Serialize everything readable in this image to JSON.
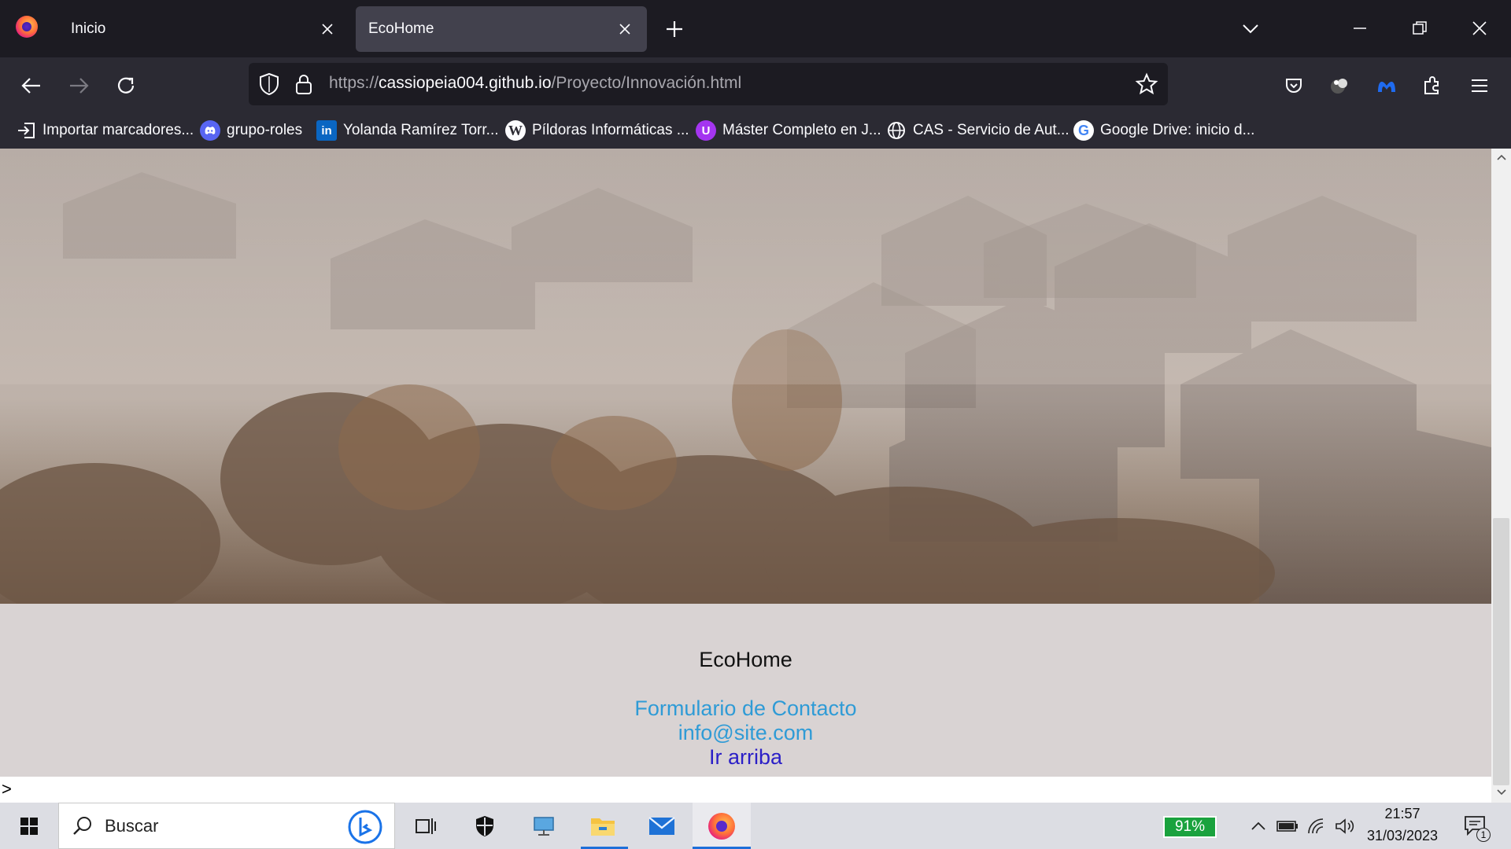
{
  "tabs": [
    {
      "label": "Inicio",
      "active": false
    },
    {
      "label": "EcoHome",
      "active": true
    }
  ],
  "url": {
    "protocol": "https://",
    "host": "cassiopeia004.github.io",
    "path": "/Proyecto/Innovación.html"
  },
  "bookmarks": [
    {
      "label": "Importar marcadores...",
      "icon": "import-icon"
    },
    {
      "label": "grupo-roles",
      "icon": "discord-icon"
    },
    {
      "label": "Yolanda Ramírez Torr...",
      "icon": "linkedin-icon"
    },
    {
      "label": "Píldoras Informáticas ...",
      "icon": "wordpress-icon"
    },
    {
      "label": "Máster Completo en J...",
      "icon": "udemy-icon"
    },
    {
      "label": "CAS - Servicio de Aut...",
      "icon": "globe-icon"
    },
    {
      "label": "Google Drive: inicio d...",
      "icon": "google-icon"
    }
  ],
  "page": {
    "footer_title": "EcoHome",
    "links": {
      "contact_form": "Formulario de Contacto",
      "email": "info@site.com",
      "back_to_top": "Ir arriba"
    },
    "stray_text": ">"
  },
  "taskbar": {
    "search_placeholder": "Buscar",
    "battery": "91%",
    "time": "21:57",
    "date": "31/03/2023",
    "notifications": "1"
  },
  "colors": {
    "link": "#2f9bd6",
    "visited_link": "#2b1fc7",
    "footer_bg": "#d9d3d3",
    "browser_chrome": "#2b2a33",
    "tab_strip": "#1c1b22",
    "active_tab": "#42414d",
    "battery_green": "#1aa23e"
  }
}
